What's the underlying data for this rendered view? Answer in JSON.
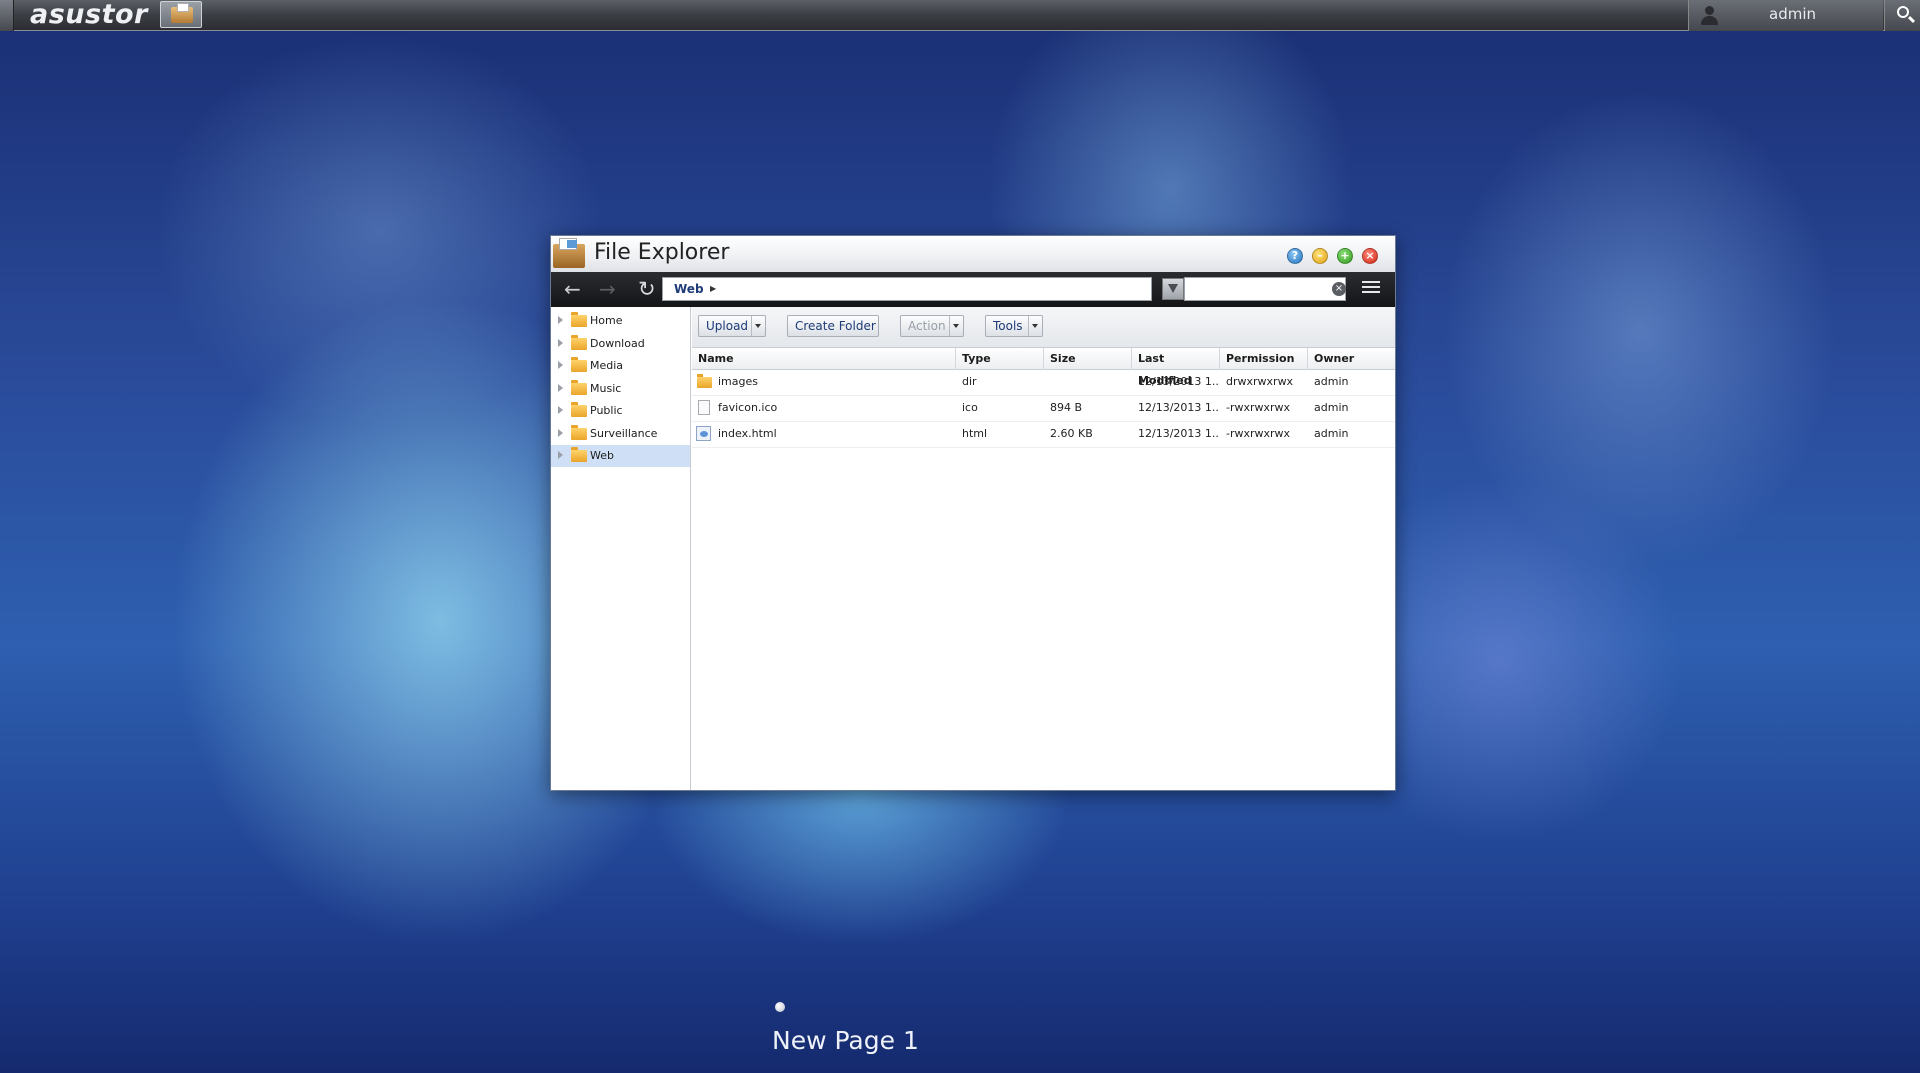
{
  "topbar": {
    "logo": "asustor",
    "user_name": "admin"
  },
  "window": {
    "title": "File Explorer",
    "path": [
      "Web"
    ],
    "filter_placeholder": ""
  },
  "sidebar": {
    "items": [
      {
        "label": "Home",
        "selected": false
      },
      {
        "label": "Download",
        "selected": false
      },
      {
        "label": "Media",
        "selected": false
      },
      {
        "label": "Music",
        "selected": false
      },
      {
        "label": "Public",
        "selected": false
      },
      {
        "label": "Surveillance",
        "selected": false
      },
      {
        "label": "Web",
        "selected": true
      }
    ]
  },
  "actions": {
    "upload": "Upload",
    "create_folder": "Create Folder",
    "action": "Action",
    "tools": "Tools"
  },
  "table": {
    "columns": [
      "Name",
      "Type",
      "Size",
      "Last Modified",
      "Permission",
      "Owner"
    ],
    "rows": [
      {
        "name": "images",
        "type": "dir",
        "size": "",
        "modified": "12/13/2013 1...",
        "permission": "drwxrwxrwx",
        "owner": "admin",
        "icon": "folder-icon"
      },
      {
        "name": "favicon.ico",
        "type": "ico",
        "size": "894 B",
        "modified": "12/13/2013 1...",
        "permission": "-rwxrwxrwx",
        "owner": "admin",
        "icon": "file-icon"
      },
      {
        "name": "index.html",
        "type": "html",
        "size": "2.60 KB",
        "modified": "12/13/2013 1...",
        "permission": "-rwxrwxrwx",
        "owner": "admin",
        "icon": "html-file-icon"
      }
    ]
  },
  "desktop": {
    "page_label": "New Page 1"
  },
  "colors": {
    "accent": "#1d3c78",
    "selection": "#cfe0f6"
  }
}
